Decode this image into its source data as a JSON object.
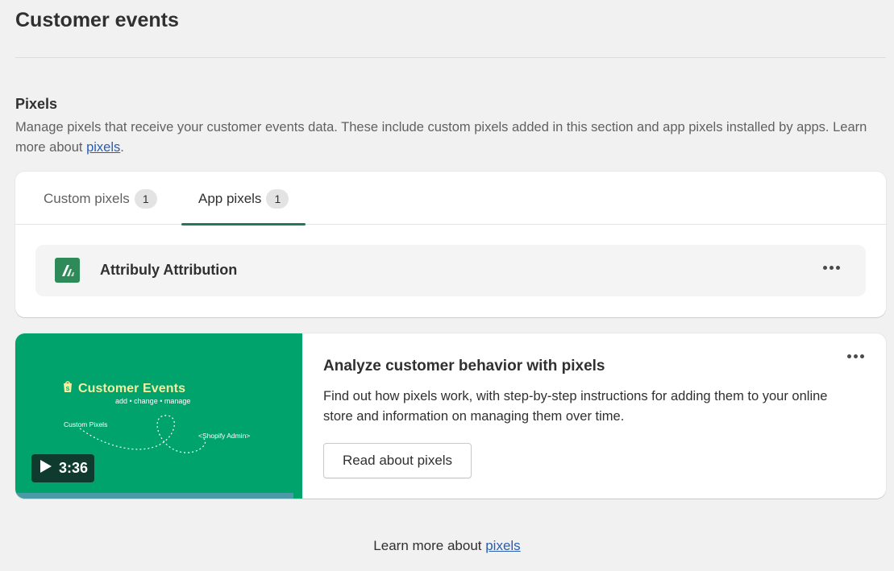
{
  "page": {
    "title": "Customer events"
  },
  "pixels_section": {
    "title": "Pixels",
    "description": "Manage pixels that receive your customer events data. These include custom pixels added in this section and app pixels installed by apps. Learn more about ",
    "link_text": "pixels",
    "description_end": "."
  },
  "tabs": [
    {
      "label": "Custom pixels",
      "count": "1",
      "selected": false
    },
    {
      "label": "App pixels",
      "count": "1",
      "selected": true
    }
  ],
  "app_pixels": [
    {
      "name": "Attribuly Attribution",
      "logo_icon": "attribuly-logo-icon",
      "logo_color": "#2e8a58"
    }
  ],
  "promo": {
    "video": {
      "thumbnail_title": "Customer Events",
      "thumbnail_subtitle": "add • change • manage",
      "thumbnail_label_left": "Custom Pixels",
      "thumbnail_label_right": "<Shopify Admin>",
      "duration": "3:36",
      "background_color": "#00a36c"
    },
    "title": "Analyze customer behavior with pixels",
    "description": "Find out how pixels work, with step-by-step instructions for adding them to your online store and information on managing them over time.",
    "button_label": "Read about pixels"
  },
  "footer": {
    "text": "Learn more about ",
    "link_text": "pixels"
  },
  "colors": {
    "accent": "#1f7a5a",
    "link": "#2a5db0",
    "background": "#f1f1f1"
  }
}
